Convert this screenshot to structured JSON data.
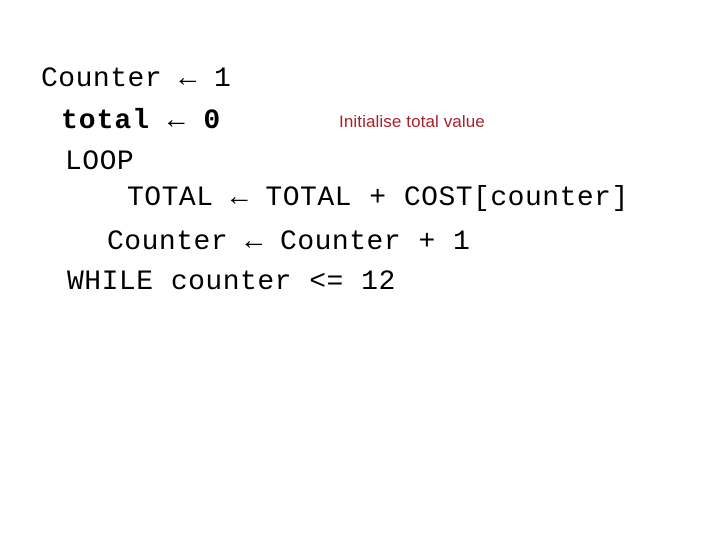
{
  "slide": {
    "background_color": "#FFFFFF",
    "code_color": "#000000",
    "annotation_color": "#A8212B",
    "pseudocode": {
      "lines": [
        {
          "text": "Counter ← 1",
          "bold": false,
          "indent_level": 0
        },
        {
          "text": "total ← 0",
          "bold": true,
          "indent_level": 1
        },
        {
          "text": "LOOP",
          "bold": false,
          "indent_level": 1
        },
        {
          "text": "TOTAL ← TOTAL + COST[counter]",
          "bold": false,
          "indent_level": 3
        },
        {
          "text": "Counter ← Counter + 1",
          "bold": false,
          "indent_level": 2
        },
        {
          "text": "WHILE counter <= 12",
          "bold": false,
          "indent_level": 1
        }
      ]
    },
    "annotations": [
      {
        "text": "Initialise total value",
        "color": "#A8212B"
      }
    ]
  }
}
